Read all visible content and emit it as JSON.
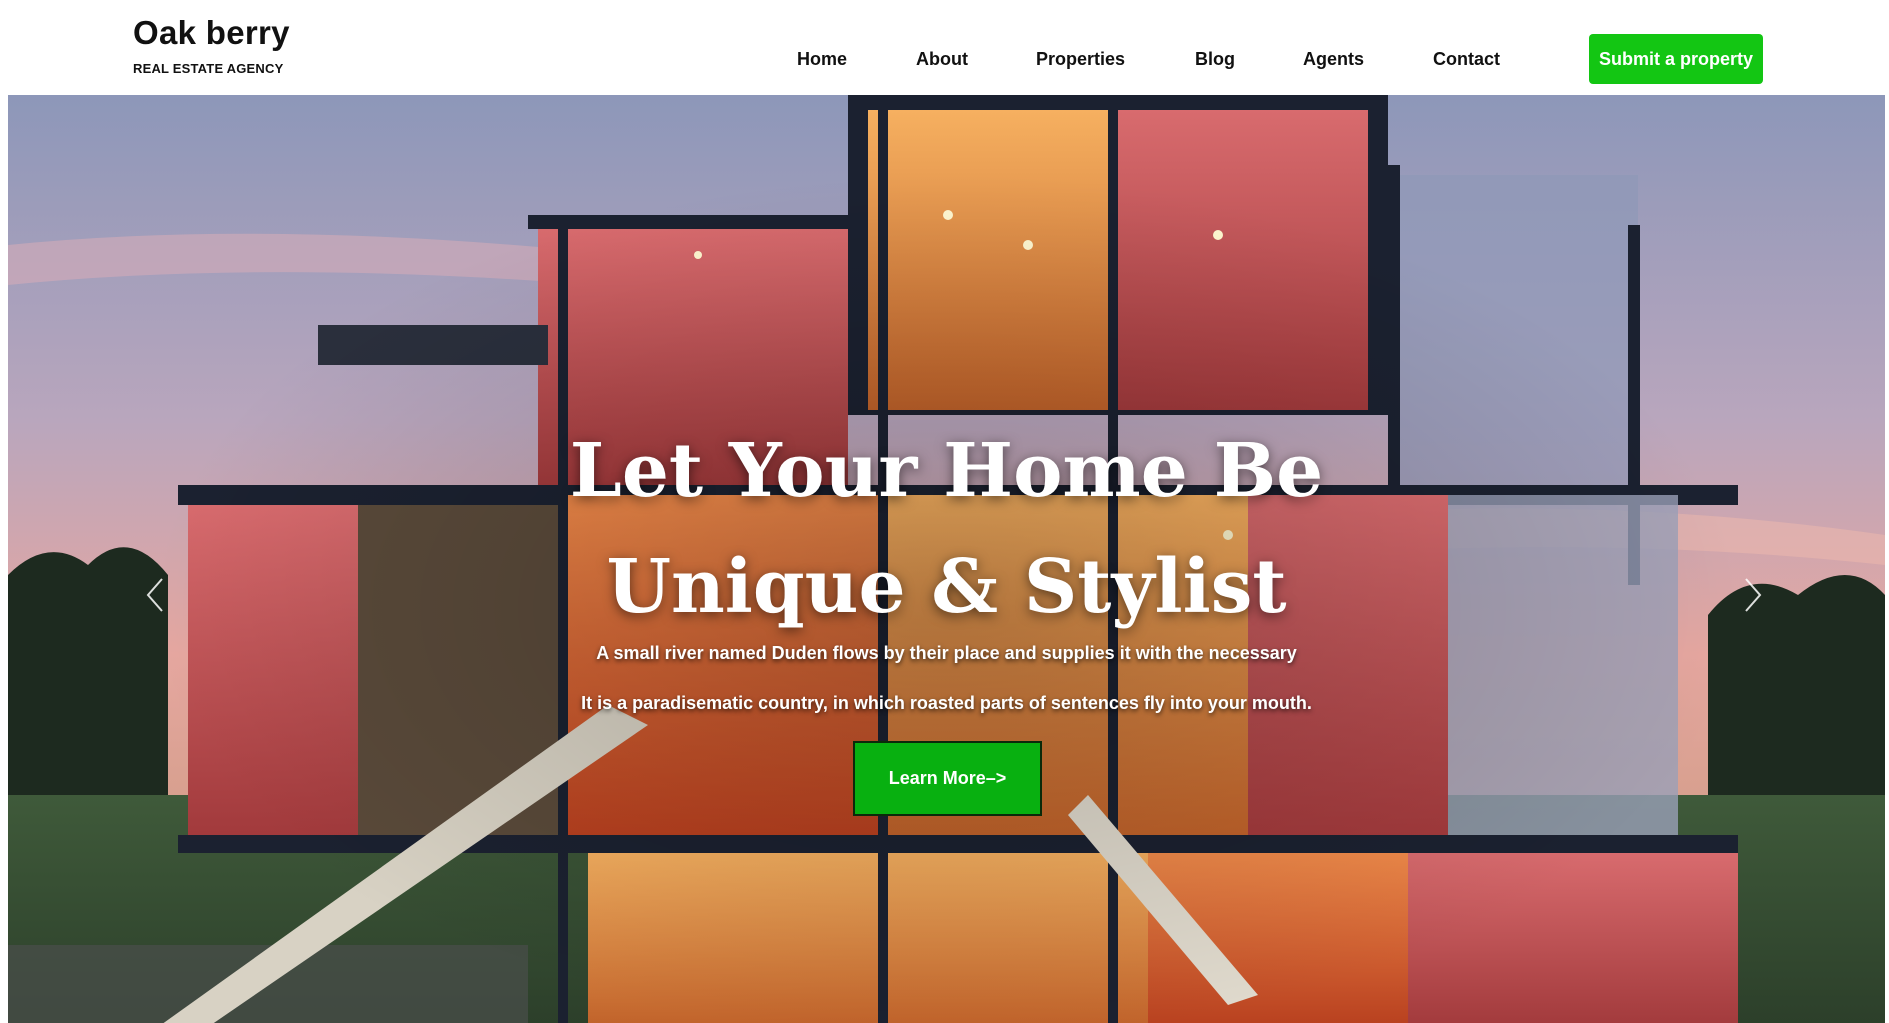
{
  "brand": {
    "name": "Oak berry",
    "tagline": "REAL ESTATE AGENCY"
  },
  "nav": {
    "items": [
      {
        "label": "Home"
      },
      {
        "label": "About"
      },
      {
        "label": "Properties"
      },
      {
        "label": "Blog"
      },
      {
        "label": "Agents"
      },
      {
        "label": "Contact"
      }
    ],
    "cta_label": "Submit a property"
  },
  "hero": {
    "title_line1": "Let Your Home Be",
    "title_line2": "Unique & Stylist",
    "subtitle_line1": "A small river named Duden flows by their place and supplies it with the necessary",
    "subtitle_line2": "It is a paradisematic country, in which roasted parts of sentences fly into your mouth.",
    "button_label": "Learn More–>",
    "prev_icon": "chevron-left-icon",
    "next_icon": "chevron-right-icon"
  },
  "colors": {
    "accent": "#13c613",
    "button": "#08b010",
    "text": "#111111"
  }
}
